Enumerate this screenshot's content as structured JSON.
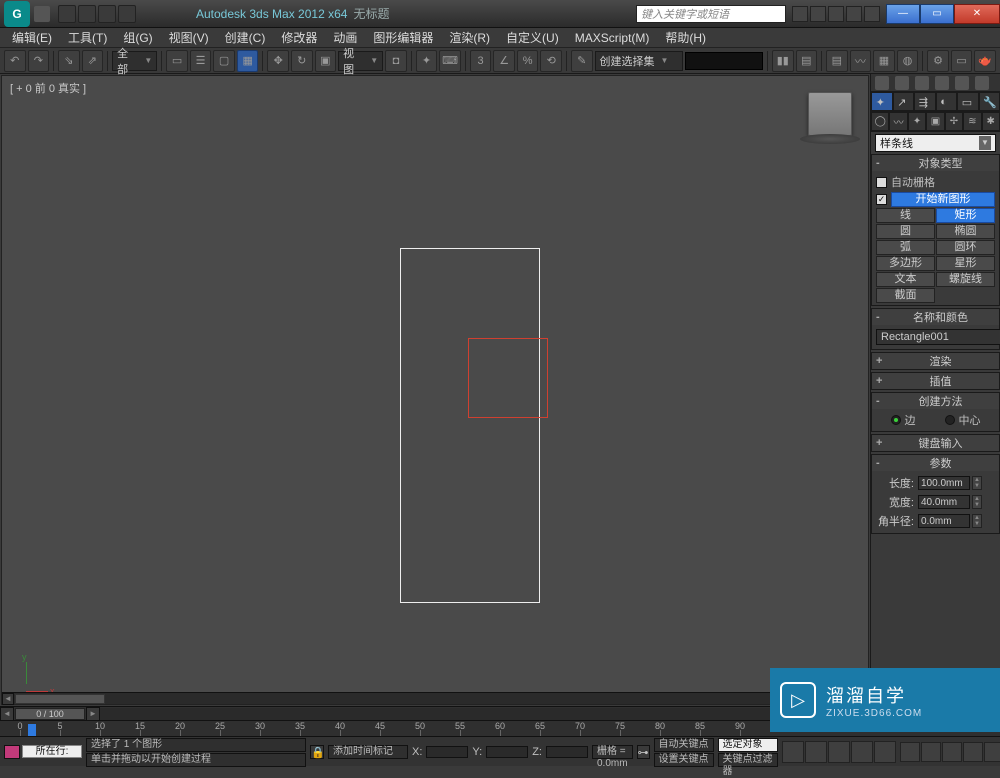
{
  "titlebar": {
    "app_letter": "G",
    "title": "Autodesk 3ds Max  2012 x64",
    "file": "无标题",
    "search_placeholder": "键入关键字或短语",
    "min": "—",
    "max": "▭",
    "close": "✕"
  },
  "menu": [
    "编辑(E)",
    "工具(T)",
    "组(G)",
    "视图(V)",
    "创建(C)",
    "修改器",
    "动画",
    "图形编辑器",
    "渲染(R)",
    "自定义(U)",
    "MAXScript(M)",
    "帮助(H)"
  ],
  "toolbar": {
    "filter": "全部",
    "viewlabel": "视图",
    "selset_label": "创建选择集"
  },
  "viewport": {
    "label": "[ + 0 前 0 真实 ]",
    "axis_x": "x",
    "axis_y": "y"
  },
  "cmdpanel": {
    "category": "样条线",
    "rollouts": {
      "objtype": {
        "title": "对象类型",
        "autogrid": "自动栅格",
        "startnew": "开始新图形",
        "buttons": [
          "线",
          "矩形",
          "圆",
          "椭圆",
          "弧",
          "圆环",
          "多边形",
          "星形",
          "文本",
          "螺旋线",
          "截面"
        ]
      },
      "namecolor": {
        "title": "名称和颜色",
        "name": "Rectangle001"
      },
      "render": {
        "title": "渲染"
      },
      "interp": {
        "title": "插值"
      },
      "method": {
        "title": "创建方法",
        "edge": "边",
        "center": "中心"
      },
      "keyboard": {
        "title": "键盘输入"
      },
      "params": {
        "title": "参数",
        "rows": [
          {
            "label": "长度:",
            "value": "100.0mm"
          },
          {
            "label": "宽度:",
            "value": "40.0mm"
          },
          {
            "label": "角半径:",
            "value": "0.0mm"
          }
        ]
      }
    }
  },
  "time": {
    "slider": "0 / 100",
    "ticks": [
      0,
      5,
      10,
      15,
      20,
      25,
      30,
      35,
      40,
      45,
      50,
      55,
      60,
      65,
      70,
      75,
      80,
      85,
      90
    ]
  },
  "status": {
    "row_label": "所在行:",
    "sel": "选择了 1 个图形",
    "hint": "单击并拖动以开始创建过程",
    "addmarker": "添加时间标记",
    "x": "X:",
    "y": "Y:",
    "z": "Z:",
    "grid_label": "栅格",
    "grid_val": "= 0.0mm",
    "autokey": "自动关键点",
    "setkey": "设置关键点",
    "selset": "选定对象",
    "keyfilter": "关键点过滤器"
  },
  "watermark": {
    "brand": "溜溜自学",
    "url": "ZIXUE.3D66.COM",
    "logo": "▷"
  }
}
